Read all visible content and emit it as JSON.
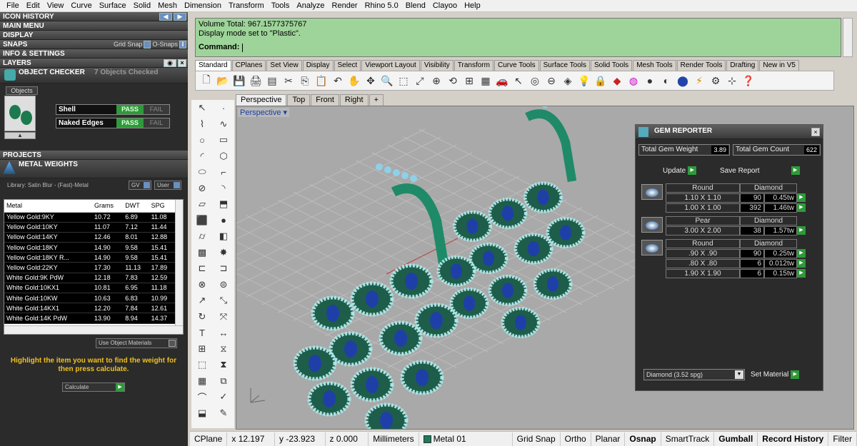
{
  "menu": [
    "File",
    "Edit",
    "View",
    "Curve",
    "Surface",
    "Solid",
    "Mesh",
    "Dimension",
    "Transform",
    "Tools",
    "Analyze",
    "Render",
    "Rhino 5.0",
    "Blend",
    "Clayoo",
    "Help"
  ],
  "left_panel": {
    "headers": [
      "ICON HISTORY",
      "MAIN MENU",
      "DISPLAY",
      "SNAPS",
      "INFO & SETTINGS",
      "LAYERS"
    ],
    "snaps": {
      "grid_snap": "Grid Snap",
      "o_snaps": "O-Snaps"
    },
    "object_checker": {
      "title": "OBJECT CHECKER",
      "count": "7 Objects Checked",
      "objects_tab": "Objects",
      "checks": [
        {
          "name": "Shell",
          "pass": "PASS",
          "fail": "FAIL"
        },
        {
          "name": "Naked Edges",
          "pass": "PASS",
          "fail": "FAIL"
        }
      ]
    },
    "projects": "PROJECTS",
    "metal_weights": {
      "title": "METAL WEIGHTS",
      "library": "Library: Satin Blur - (Fast)-Metal",
      "gv": "GV",
      "user": "User",
      "columns": [
        "Metal",
        "Grams",
        "DWT",
        "SPG"
      ],
      "rows": [
        [
          "Yellow Gold:9KY",
          "10.72",
          "6.89",
          "11.08"
        ],
        [
          "Yellow Gold:10KY",
          "11.07",
          "7.12",
          "11.44"
        ],
        [
          "Yellow Gold:14KY",
          "12.46",
          "8.01",
          "12.88"
        ],
        [
          "Yellow Gold:18KY",
          "14.90",
          "9.58",
          "15.41"
        ],
        [
          "Yellow Gold:18KY R...",
          "14.90",
          "9.58",
          "15.41"
        ],
        [
          "Yellow Gold:22KY",
          "17.30",
          "11.13",
          "17.89"
        ],
        [
          "White Gold:9K PdW",
          "12.18",
          "7.83",
          "12.59"
        ],
        [
          "White Gold:10KX1",
          "10.81",
          "6.95",
          "11.18"
        ],
        [
          "White Gold:10KW",
          "10.63",
          "6.83",
          "10.99"
        ],
        [
          "White Gold:14KX1",
          "12.20",
          "7.84",
          "12.61"
        ],
        [
          "White Gold:14K PdW",
          "13.90",
          "8.94",
          "14.37"
        ]
      ],
      "use_object_materials": "Use Object Materials",
      "hint": "Highlight the item you want to find the weight for then press calculate.",
      "calculate": "Calculate"
    }
  },
  "command": {
    "lines": [
      "Volume Total: 967.1577375767",
      "Display mode set to \"Plastic\"."
    ],
    "prompt": "Command:"
  },
  "toolbar_tabs": [
    "Standard",
    "CPlanes",
    "Set View",
    "Display",
    "Select",
    "Viewport Layout",
    "Visibility",
    "Transform",
    "Curve Tools",
    "Surface Tools",
    "Solid Tools",
    "Mesh Tools",
    "Render Tools",
    "Drafting",
    "New in V5"
  ],
  "viewport_tabs": [
    "Perspective",
    "Top",
    "Front",
    "Right",
    "+"
  ],
  "viewport_title": "Perspective",
  "gem_reporter": {
    "title": "GEM REPORTER",
    "total_weight_label": "Total Gem Weight",
    "total_weight": "3.89",
    "total_count_label": "Total Gem Count",
    "total_count": "622",
    "update": "Update",
    "save_report": "Save Report",
    "groups": [
      {
        "shape": "Round",
        "material": "Diamond",
        "rows": [
          [
            "1.10 X 1.10",
            "90",
            "0.45tw"
          ],
          [
            "1.00 X 1.00",
            "392",
            "1.46tw"
          ]
        ]
      },
      {
        "shape": "Pear",
        "material": "Diamond",
        "rows": [
          [
            "3.00 X 2.00",
            "38",
            "1.57tw"
          ]
        ]
      },
      {
        "shape": "Round",
        "material": "Diamond",
        "rows": [
          [
            ".90 X .90",
            "90",
            "0.25tw"
          ],
          [
            ".80 X .80",
            "6",
            "0.012tw"
          ],
          [
            "1.90 X 1.90",
            "6",
            "0.15tw"
          ]
        ]
      }
    ],
    "material_select": "Diamond    (3.52 spg)",
    "set_material": "Set Material"
  },
  "status": {
    "cplane": "CPlane",
    "x": "x 12.197",
    "y": "y -23.923",
    "z": "z 0.000",
    "units": "Millimeters",
    "layer": "Metal 01",
    "toggles": [
      "Grid Snap",
      "Ortho",
      "Planar",
      "Osnap",
      "SmartTrack",
      "Gumball",
      "Record History",
      "Filter"
    ],
    "layer_color": "#1d7a5a"
  }
}
